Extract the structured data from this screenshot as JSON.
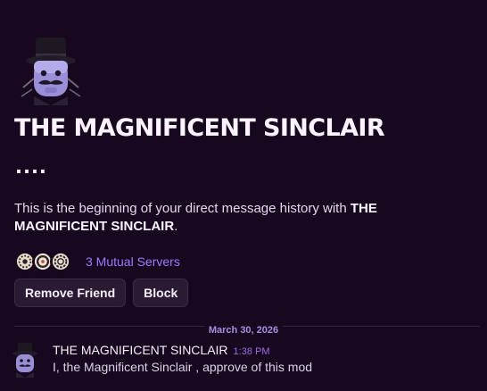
{
  "profile": {
    "display_name": "THE MAGNIFICENT SINCLAIR",
    "username": "....",
    "avatar_icon": "sinclair-avatar-icon"
  },
  "intro": {
    "prefix": "This is the beginning of your direct message history with ",
    "name": "THE MAGNIFICENT SINCLAIR",
    "suffix": "."
  },
  "mutual": {
    "label": "3 Mutual Servers",
    "server_icons": [
      "server-icon-1",
      "server-icon-2",
      "server-icon-3"
    ]
  },
  "actions": {
    "remove_friend": "Remove Friend",
    "block": "Block"
  },
  "divider": {
    "date": "March 30, 2026"
  },
  "messages": [
    {
      "author": "THE MAGNIFICENT SINCLAIR",
      "time": "1:38 PM",
      "content": "I, the Magnificent Sinclair , approve of this mod"
    }
  ],
  "colors": {
    "background": "#17071f",
    "accent": "#9d7bff",
    "timestamp": "#9a6fe0",
    "button_bg": "#2a1b33"
  }
}
